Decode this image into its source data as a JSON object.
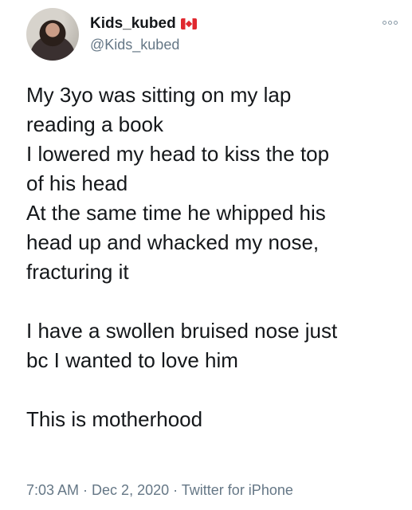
{
  "author": {
    "display_name": "Kids_kubed",
    "handle": "@Kids_kubed",
    "flag_icon": "canada-flag-icon"
  },
  "more_icon": "more-options-icon",
  "tweet": {
    "paragraph_1": "My 3yo was sitting on my lap\nreading a book\nI lowered my head to kiss the top\nof his head\nAt the same time he whipped his\nhead up and whacked my nose,\nfracturing it",
    "paragraph_2": "I have a swollen bruised nose just\nbc I wanted to love him",
    "paragraph_3": "This is motherhood"
  },
  "meta": {
    "time": "7:03 AM",
    "separator": " · ",
    "date": "Dec 2, 2020",
    "source": "Twitter for iPhone"
  }
}
